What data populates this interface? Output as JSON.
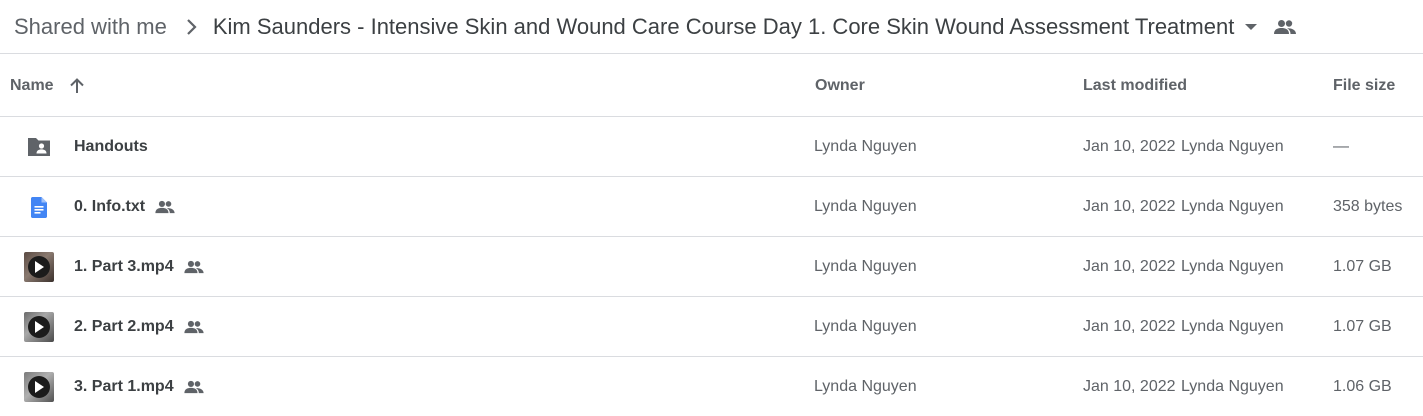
{
  "breadcrumb": {
    "root": "Shared with me",
    "current": "Kim Saunders - Intensive Skin and Wound Care Course Day 1. Core Skin Wound Assessment Treatment"
  },
  "columns": {
    "name": "Name",
    "owner": "Owner",
    "last_modified": "Last modified",
    "file_size": "File size"
  },
  "rows": [
    {
      "icon": "shared-folder-icon",
      "name": "Handouts",
      "shared": false,
      "owner": "Lynda Nguyen",
      "modified_date": "Jan 10, 2022",
      "modified_by": "Lynda Nguyen",
      "size": "—"
    },
    {
      "icon": "google-docs-icon",
      "name": "0. Info.txt",
      "shared": true,
      "owner": "Lynda Nguyen",
      "modified_date": "Jan 10, 2022",
      "modified_by": "Lynda Nguyen",
      "size": "358 bytes"
    },
    {
      "icon": "video-thumbnail-icon",
      "name": "1. Part 3.mp4",
      "shared": true,
      "owner": "Lynda Nguyen",
      "modified_date": "Jan 10, 2022",
      "modified_by": "Lynda Nguyen",
      "size": "1.07 GB"
    },
    {
      "icon": "video-thumbnail-icon",
      "name": "2. Part 2.mp4",
      "shared": true,
      "owner": "Lynda Nguyen",
      "modified_date": "Jan 10, 2022",
      "modified_by": "Lynda Nguyen",
      "size": "1.07 GB"
    },
    {
      "icon": "video-thumbnail-icon",
      "name": "3. Part 1.mp4",
      "shared": true,
      "owner": "Lynda Nguyen",
      "modified_date": "Jan 10, 2022",
      "modified_by": "Lynda Nguyen",
      "size": "1.06 GB"
    }
  ],
  "colors": {
    "text": "#3c4043",
    "secondary": "#5f6368",
    "divider": "#dadce0",
    "doc_blue": "#4285f4"
  }
}
